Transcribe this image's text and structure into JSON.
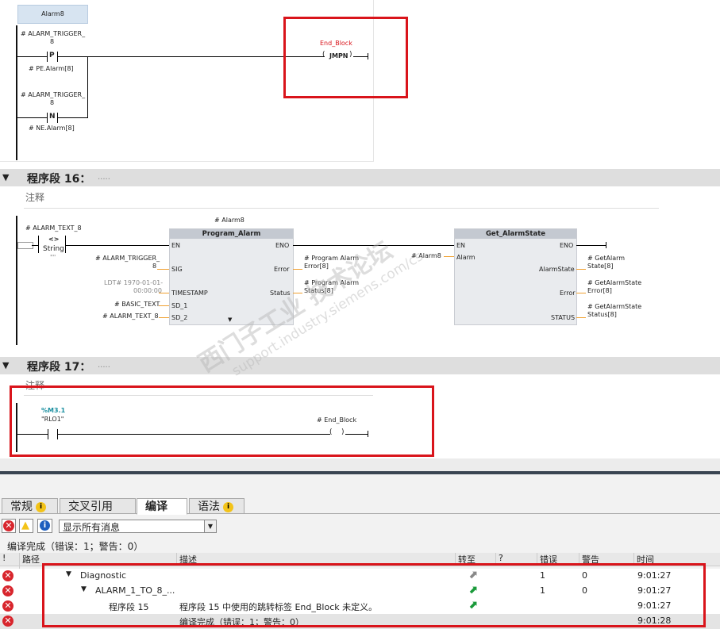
{
  "top_network": {
    "tag_box": "Alarm8",
    "contact1_label1": "# ALARM_TRIGGER_",
    "contact1_label2": "8",
    "contact1_symbol": "P",
    "contact1_sub": "# PE.Alarm[8]",
    "contact2_label1": "# ALARM_TRIGGER_",
    "contact2_label2": "8",
    "contact2_symbol": "N",
    "contact2_sub": "# NE.Alarm[8]",
    "jump_label": "End_Block",
    "jump_coil": "JMPN"
  },
  "network16": {
    "title": "程序段 16：",
    "dots": ".....",
    "comment": "注释",
    "input_tag": "# ALARM_TEXT_8",
    "convert_symbol": "<>",
    "convert_type": "String",
    "convert_sub": "\"\"",
    "block1_instance": "# Alarm8",
    "block1_name": "Program_Alarm",
    "block1_pins": {
      "en": "EN",
      "eno": "ENO",
      "sig": "SIG",
      "timestamp": "TIMESTAMP",
      "sd1": "SD_1",
      "sd2": "SD_2",
      "error": "Error",
      "status": "Status"
    },
    "sig_tag1": "# ALARM_TRIGGER_",
    "sig_tag2": "8",
    "timestamp_tag1": "LDT# 1970-01-01-",
    "timestamp_tag2": "00:00:00",
    "sd1_tag": "# BASIC_TEXT",
    "sd2_tag": "# ALARM_TEXT_8",
    "error_out1": "# Program Alarm",
    "error_out2": "Error[8]",
    "status_out1": "# Program Alarm",
    "status_out2": "Status[8]",
    "block2_name": "Get_AlarmState",
    "block2_pins": {
      "en": "EN",
      "eno": "ENO",
      "alarm": "Alarm",
      "alarmstate": "AlarmState",
      "error": "Error",
      "status": "STATUS"
    },
    "alarm_in": "# Alarm8",
    "out1a": "# GetAlarm",
    "out1b": "State[8]",
    "out2a": "# GetAlarmState",
    "out2b": "Error[8]",
    "out3a": "# GetAlarmState",
    "out3b": "Status[8]"
  },
  "network17": {
    "title": "程序段 17：",
    "dots": ".....",
    "comment": "注释",
    "contact_addr": "%M3.1",
    "contact_name": "\"RLO1\"",
    "coil_label": "# End_Block"
  },
  "watermark": {
    "line1": "西门子工业 技术论坛",
    "line2": "support.industry.siemens.com/cs"
  },
  "inspector": {
    "tabs": [
      {
        "label": "常规",
        "warn": true
      },
      {
        "label": "交叉引用",
        "warn": false
      },
      {
        "label": "编译",
        "warn": false
      },
      {
        "label": "语法",
        "warn": true
      }
    ],
    "filter_value": "显示所有消息",
    "summary": "编译完成（错误：1；警告：0）",
    "columns": {
      "bang": "!",
      "path": "路径",
      "desc": "描述",
      "goto": "转至",
      "q": "?",
      "errors": "错误",
      "warnings": "警告",
      "time": "时间"
    },
    "rows": [
      {
        "path": "Diagnostic",
        "desc": "",
        "errors": "1",
        "warnings": "0",
        "time": "9:01:27",
        "goto": true
      },
      {
        "path": "ALARM_1_TO_8_...",
        "desc": "",
        "errors": "1",
        "warnings": "0",
        "time": "9:01:27",
        "goto": true
      },
      {
        "path": "程序段 15",
        "desc": "程序段 15 中使用的跳转标签 End_Block 未定义。",
        "errors": "",
        "warnings": "",
        "time": "9:01:27",
        "goto": true
      },
      {
        "path": "",
        "desc": "编译完成（错误：1；警告：0）",
        "errors": "",
        "warnings": "",
        "time": "9:01:28",
        "goto": false
      }
    ]
  },
  "colors": {
    "highlight": "#d9141b",
    "tag_green": "#1a8fa0",
    "wire_orange": "#f0a030"
  }
}
